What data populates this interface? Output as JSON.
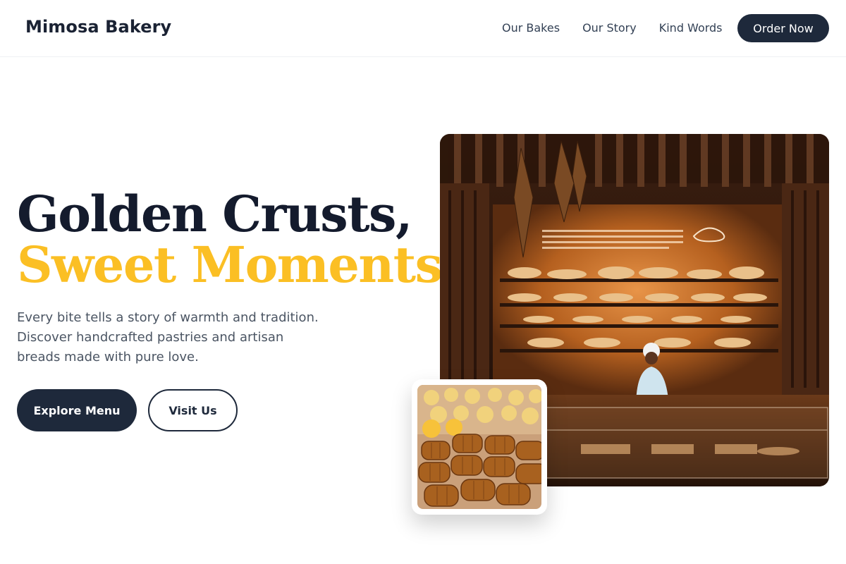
{
  "nav": {
    "brand": "Mimosa Bakery",
    "links": [
      "Our Bakes",
      "Our Story",
      "Kind Words"
    ],
    "cta": "Order Now"
  },
  "hero": {
    "headline_line1": "Golden Crusts,",
    "headline_line2": "Sweet Moments.",
    "lead": "Every bite tells a story of warmth and tradition. Discover handcrafted pastries and artisan breads made with pure love.",
    "primary_button": "Explore Menu",
    "secondary_button": "Visit Us"
  },
  "colors": {
    "dark": "#1e293b",
    "accent": "#fbbf24",
    "body_text": "#4b5563"
  }
}
